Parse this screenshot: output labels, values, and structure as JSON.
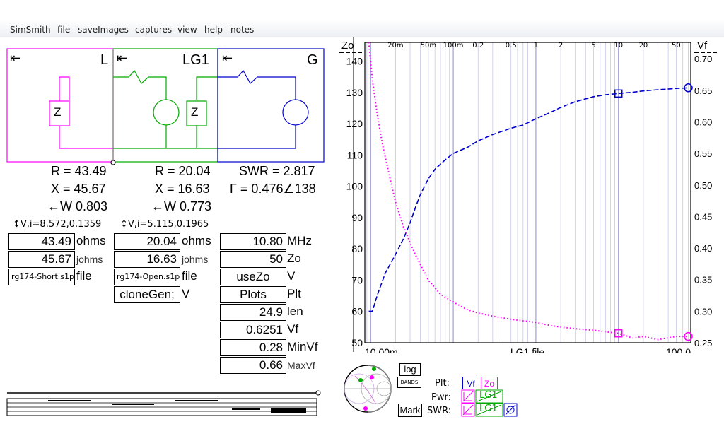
{
  "menu": [
    "SimSmith",
    "file",
    "saveImages",
    "captures",
    "view",
    "help",
    "notes"
  ],
  "blocks": {
    "L": {
      "label": "L",
      "color": "#ff00ff",
      "arrow": "⇤",
      "element": "Z"
    },
    "LG1": {
      "label": "LG1",
      "color": "#00aa00",
      "arrow": "⇤",
      "element": "Z"
    },
    "G": {
      "label": "G",
      "color": "#0000cc",
      "arrow": "⇤"
    }
  },
  "readouts": {
    "L": {
      "r": "R = 43.49",
      "x": "X = 45.67",
      "w": "←W 0.803",
      "vi": "↕V,i=8.572,0.1359"
    },
    "LG1": {
      "r": "R = 20.04",
      "x": "X = 16.63",
      "w": "←W 0.773",
      "vi": "↕V,i=5.115,0.1965"
    },
    "G": {
      "swr": "SWR = 2.817",
      "gamma": "Γ = 0.476∠138"
    }
  },
  "L_fields": {
    "ohms": "43.49",
    "ohms_unit": "ohms",
    "johms": "45.67",
    "johms_unit": "johms",
    "file": "rg174-Short.s1p",
    "file_unit": "file"
  },
  "LG1_fields": {
    "ohms": "20.04",
    "ohms_unit": "ohms",
    "johms": "16.63",
    "johms_unit": "johms",
    "file": "rg174-Open.s1p",
    "file_unit": "file",
    "clone": "cloneGen;",
    "clone_unit": "V"
  },
  "G_fields": {
    "mhz": "10.80",
    "mhz_unit": "MHz",
    "zo": "50",
    "zo_unit": "Zo",
    "usezo": "useZo",
    "usezo_unit": "V",
    "plots": "Plots",
    "plots_unit": "Plt",
    "len": "24.9",
    "len_unit": "len",
    "vf": "0.6251",
    "vf_unit": "Vf",
    "minvf": "0.28",
    "minvf_unit": "MinVf",
    "maxvf": "0.66",
    "maxvf_unit": "MaxVf"
  },
  "controls": {
    "log": "log",
    "bands": "BANDS",
    "mark": "Mark",
    "plt_label": "Plt:",
    "pwr_label": "Pwr:",
    "swr_label": "SWR:",
    "vf_chip": "Vf",
    "zo_chip": "Zo",
    "lg1_chip": "LG1",
    "colors": {
      "vf": "#0000cc",
      "zo": "#ff00ff",
      "lg1": "#00aa00"
    }
  },
  "chart_data": {
    "type": "line",
    "xscale": "log",
    "xlim": [
      0.0085,
      75
    ],
    "top_ticks": [
      {
        "x": 0.02,
        "label": "20m"
      },
      {
        "x": 0.05,
        "label": "50m"
      },
      {
        "x": 0.1,
        "label": "100m"
      },
      {
        "x": 0.2,
        "label": "0.2"
      },
      {
        "x": 0.5,
        "label": "0.5"
      },
      {
        "x": 1,
        "label": "1"
      },
      {
        "x": 2,
        "label": "2"
      },
      {
        "x": 5,
        "label": "5"
      },
      {
        "x": 10,
        "label": "10"
      },
      {
        "x": 20,
        "label": "20"
      },
      {
        "x": 50,
        "label": "50"
      }
    ],
    "bottom_labels": {
      "left": "10.00m",
      "center": "LG1.file",
      "right": "100.0"
    },
    "left_axis": {
      "title": "Zo",
      "ylim": [
        50,
        146
      ],
      "ticks": [
        50,
        60,
        70,
        80,
        90,
        100,
        110,
        120,
        130,
        140
      ]
    },
    "right_axis": {
      "title": "Vf",
      "ylim": [
        0.25,
        0.726
      ],
      "ticks": [
        "0.25",
        "0.30",
        "0.35",
        "0.40",
        "0.45",
        "0.50",
        "0.55",
        "0.60",
        "0.65",
        "0.70"
      ]
    },
    "series": [
      {
        "name": "Vf",
        "axis": "right",
        "color": "#0000cc",
        "style": "dashed",
        "x": [
          0.0095,
          0.0105,
          0.012,
          0.015,
          0.02,
          0.025,
          0.03,
          0.035,
          0.04,
          0.05,
          0.06,
          0.08,
          0.1,
          0.15,
          0.2,
          0.3,
          0.5,
          0.7,
          1,
          1.5,
          2,
          3,
          5,
          7,
          10,
          15,
          20,
          30,
          50,
          70
        ],
        "y": [
          0.3,
          0.3,
          0.325,
          0.36,
          0.39,
          0.415,
          0.44,
          0.465,
          0.485,
          0.51,
          0.525,
          0.54,
          0.55,
          0.56,
          0.57,
          0.58,
          0.59,
          0.595,
          0.605,
          0.615,
          0.623,
          0.632,
          0.64,
          0.643,
          0.645,
          0.647,
          0.649,
          0.651,
          0.653,
          0.654
        ]
      },
      {
        "name": "Zo",
        "axis": "left",
        "color": "#ff00ff",
        "style": "dotted",
        "x": [
          0.0095,
          0.0105,
          0.012,
          0.014,
          0.017,
          0.02,
          0.025,
          0.03,
          0.035,
          0.04,
          0.05,
          0.07,
          0.1,
          0.15,
          0.2,
          0.3,
          0.5,
          0.7,
          1,
          1.5,
          2,
          3,
          5,
          7,
          10,
          15,
          20,
          30,
          50,
          70
        ],
        "y": [
          146,
          134,
          123,
          113,
          103,
          95,
          87,
          82,
          78,
          75,
          70,
          65.5,
          63,
          60.5,
          59.5,
          58.5,
          57.5,
          57,
          56.5,
          55.5,
          55,
          54.5,
          54,
          53.5,
          53,
          51.5,
          52,
          51,
          52,
          52
        ]
      }
    ],
    "markers": [
      {
        "series": "Vf",
        "x": 10,
        "shape": "square"
      },
      {
        "series": "Vf",
        "x": 70,
        "shape": "circle"
      },
      {
        "series": "Zo",
        "x": 10,
        "shape": "square"
      },
      {
        "series": "Zo",
        "x": 70,
        "shape": "circle"
      }
    ]
  }
}
